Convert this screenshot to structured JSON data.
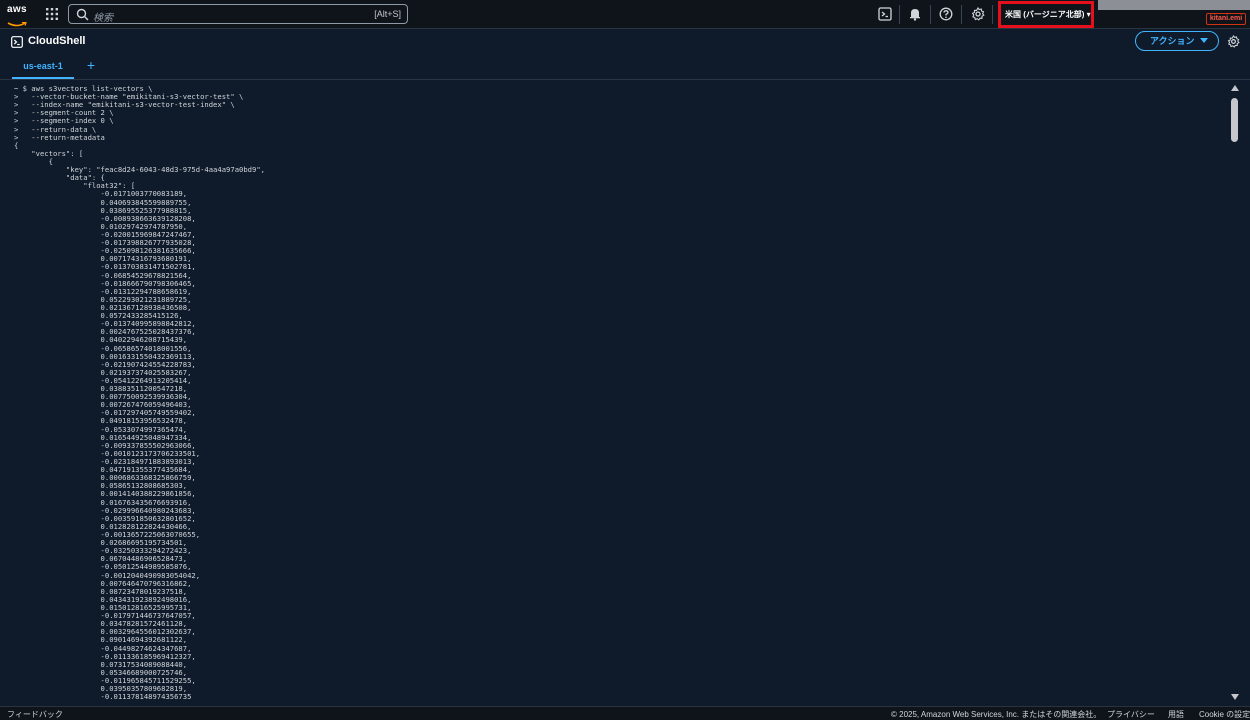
{
  "topnav": {
    "logo_text": "aws",
    "search": {
      "placeholder": "検索",
      "shortcut": "[Alt+S]"
    },
    "region_label": "米国 (バージニア北部) ▾",
    "user_badge": "kitani.emi",
    "icons": [
      "cloudshell-icon",
      "bell-icon",
      "help-icon",
      "gear-icon"
    ]
  },
  "header": {
    "title": "CloudShell",
    "action_label": "アクション"
  },
  "tabs": [
    {
      "label": "us-east-1",
      "active": true
    }
  ],
  "tab_add_label": "+",
  "terminal": {
    "lines": [
      "~ $ aws s3vectors list-vectors \\",
      ">   --vector-bucket-name \"emikitani-s3-vector-test\" \\",
      ">   --index-name \"emikitani-s3-vector-test-index\" \\",
      ">   --segment-count 2 \\",
      ">   --segment-index 0 \\",
      ">   --return-data \\",
      ">   --return-metadata",
      "{",
      "    \"vectors\": [",
      "        {",
      "            \"key\": \"feac8d24-6043-48d3-975d-4aa4a97a0bd9\",",
      "            \"data\": {",
      "                \"float32\": [",
      "                    -0.0171003770083189,",
      "                    0.040693845599889755,",
      "                    0.038695525377988815,",
      "                    -0.008938663639128208,",
      "                    0.01029742974787950,",
      "                    -0.020015969847247467,",
      "                    -0.017398826777935028,",
      "                    -0.025098126381635666,",
      "                    0.007174316793680191,",
      "                    -0.013703831471502781,",
      "                    -0.06854529678821564,",
      "                    -0.018666790798306465,",
      "                    -0.01312294788658619,",
      "                    0.052293021231889725,",
      "                    0.021367128938436508,",
      "                    0.0572433285415126,",
      "                    -0.013740995898842812,",
      "                    0.0024767525028437376,",
      "                    0.04022946208715439,",
      "                    -0.06586574018001556,",
      "                    0.0016331550432369113,",
      "                    -0.021907424554228783,",
      "                    0.021937374025583267,",
      "                    -0.05412264913205414,",
      "                    0.03883511200547218,",
      "                    0.007750092539936304,",
      "                    0.007267476059496403,",
      "                    -0.017297405749559402,",
      "                    0.04918153956532478,",
      "                    -0.0533074997365474,",
      "                    0.016544925048947334,",
      "                    -0.009337855502963066,",
      "                    -0.0010123173706233501,",
      "                    -0.023184971883893013,",
      "                    0.047191355377435684,",
      "                    0.0006863368325866759,",
      "                    0.05865132808685303,",
      "                    0.0014140388229861856,",
      "                    0.016763435676693916,",
      "                    -0.029996640980243683,",
      "                    -0.003591850632801652,",
      "                    0.012828122824430466,",
      "                    -0.0013657225063070655,",
      "                    0.02686695195734501,",
      "                    -0.03250333294272423,",
      "                    0.06704486906528473,",
      "                    -0.05012544989585876,",
      "                    -0.0012040490983054042,",
      "                    0.007646470796316862,",
      "                    0.08723478019237518,",
      "                    0.043431923892498016,",
      "                    0.015012816525995731,",
      "                    -0.017971446737647057,",
      "                    0.03478281572461128,",
      "                    0.0032964556012302637,",
      "                    0.09014694392681122,",
      "                    -0.04498274624347687,",
      "                    -0.011336185969412327,",
      "                    0.07317534089088440,",
      "                    0.05346689000725746,",
      "                    -0.011965845711529255,",
      "                    0.03950357809682819,",
      "                    -0.011378148974356735"
    ]
  },
  "footer": {
    "feedback": "フィードバック",
    "copyright": "© 2025, Amazon Web Services, Inc. またはその関連会社。",
    "privacy": "プライバシー",
    "terms": "用語",
    "cookie": "Cookie の設定"
  }
}
